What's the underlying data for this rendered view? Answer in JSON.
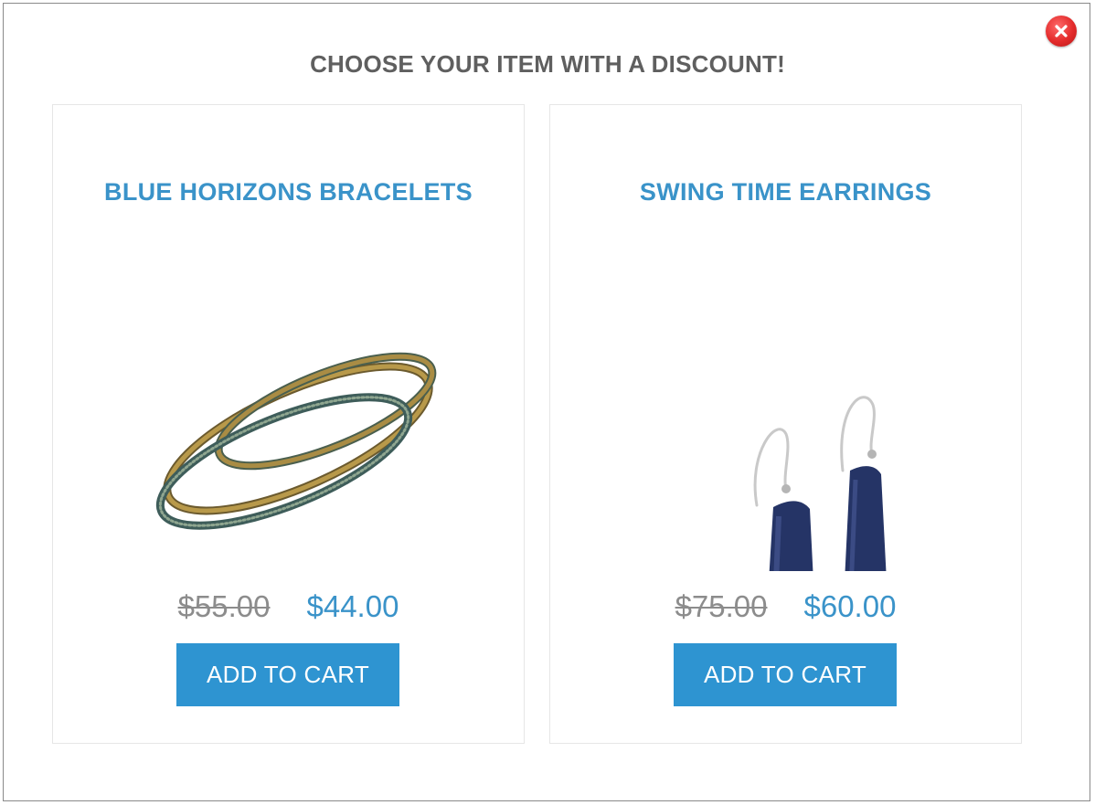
{
  "modal": {
    "title": "CHOOSE YOUR ITEM WITH A DISCOUNT!",
    "close_icon": "close-icon",
    "close_color": "#e32b2b"
  },
  "products": [
    {
      "name": "BLUE HORIZONS BRACELETS",
      "old_price": "$55.00",
      "new_price": "$44.00",
      "button_label": "ADD TO CART"
    },
    {
      "name": "SWING TIME EARRINGS",
      "old_price": "$75.00",
      "new_price": "$60.00",
      "button_label": "ADD TO CART"
    }
  ],
  "colors": {
    "accent": "#3a93c9",
    "button": "#2e94d1",
    "old_price": "#8c8c8c",
    "title": "#5f5f5f"
  }
}
